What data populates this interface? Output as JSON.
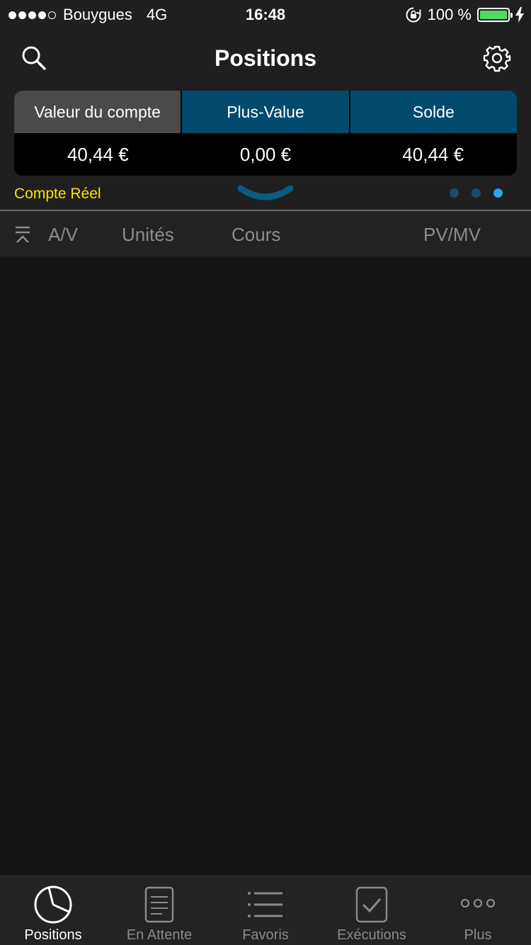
{
  "status_bar": {
    "carrier": "Bouygues",
    "network": "4G",
    "time": "16:48",
    "battery_percent": "100 %",
    "battery_color": "#4cd964"
  },
  "nav": {
    "title": "Positions",
    "search_icon": "search-icon",
    "settings_icon": "gear-icon"
  },
  "summary": {
    "headers": [
      "Valeur du compte",
      "Plus-Value",
      "Solde"
    ],
    "values": [
      "40,44 €",
      "0,00 €",
      "40,44 €"
    ],
    "account_type": "Compte Réel",
    "active_page_dot": 3,
    "page_count": 3
  },
  "columns": {
    "sort_icon": "sort-up-icon",
    "labels": [
      "A/V",
      "Unités",
      "Cours",
      "PV/MV"
    ]
  },
  "tabs": [
    {
      "label": "Positions",
      "icon": "pie-chart-icon",
      "active": true
    },
    {
      "label": "En Attente",
      "icon": "document-icon",
      "active": false
    },
    {
      "label": "Favoris",
      "icon": "list-icon",
      "active": false
    },
    {
      "label": "Exécutions",
      "icon": "checkbox-icon",
      "active": false
    },
    {
      "label": "Plus",
      "icon": "more-icon",
      "active": false
    }
  ],
  "colors": {
    "accent_blue": "#024a6e",
    "account_type_yellow": "#f5e400",
    "active_dot": "#2ba7e6"
  }
}
